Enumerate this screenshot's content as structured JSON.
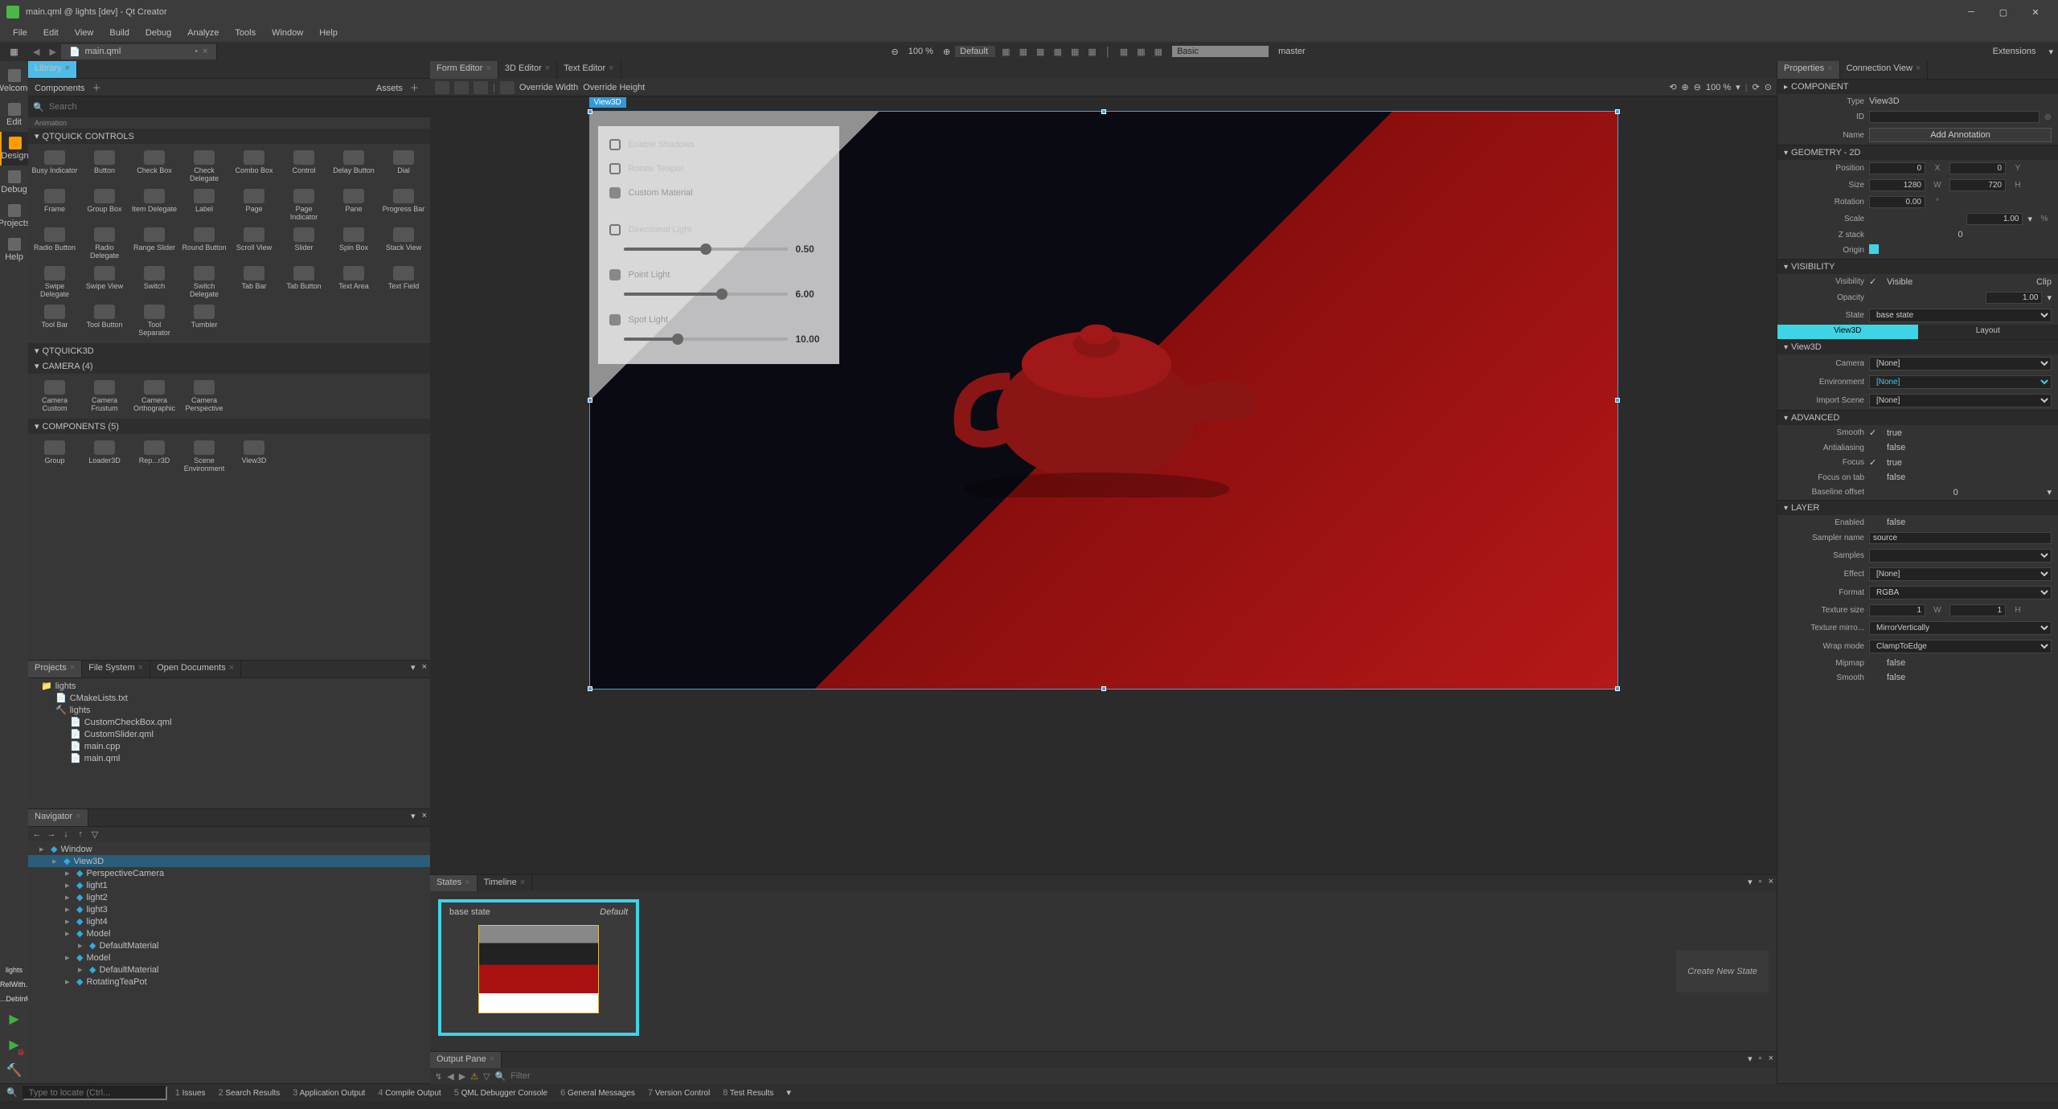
{
  "window": {
    "title": "main.qml @ lights [dev] - Qt Creator"
  },
  "menu": [
    "File",
    "Edit",
    "View",
    "Build",
    "Debug",
    "Analyze",
    "Tools",
    "Window",
    "Help"
  ],
  "file_tabs": [
    {
      "name": "main.qml",
      "active": true
    }
  ],
  "top_toolbar": {
    "zoom": "100 %",
    "style": "Default",
    "kit": "Basic",
    "branch": "master",
    "extras_label": "Extensions"
  },
  "left_modes": [
    {
      "id": "welcome",
      "label": "Welcome"
    },
    {
      "id": "edit",
      "label": "Edit"
    },
    {
      "id": "design",
      "label": "Design",
      "active": true
    },
    {
      "id": "debug",
      "label": "Debug"
    },
    {
      "id": "projects",
      "label": "Projects"
    },
    {
      "id": "help",
      "label": "Help"
    }
  ],
  "build_status": {
    "project": "lights",
    "config": "RelWith...",
    "detail": "...DebInfo"
  },
  "library": {
    "tabs": [
      "Library"
    ],
    "subtabs": {
      "left": "Components",
      "right": "Assets"
    },
    "search_placeholder": "Search",
    "sections": [
      {
        "title": "QTQUICK CONTROLS",
        "items": [
          "Busy Indicator",
          "Button",
          "Check Box",
          "Check Delegate",
          "Combo Box",
          "Control",
          "Delay Button",
          "Dial",
          "Frame",
          "Group Box",
          "Item Delegate",
          "Label",
          "Page",
          "Page Indicator",
          "Pane",
          "Progress Bar",
          "Radio Button",
          "Radio Delegate",
          "Range Slider",
          "Round Button",
          "Scroll View",
          "Slider",
          "Spin Box",
          "Stack View",
          "Swipe Delegate",
          "Swipe View",
          "Switch",
          "Switch Delegate",
          "Tab Bar",
          "Tab Button",
          "Text Area",
          "Text Field",
          "Tool Bar",
          "Tool Button",
          "Tool Separator",
          "Tumbler"
        ]
      },
      {
        "title": "QTQUICK3D",
        "items": []
      },
      {
        "title": "CAMERA (4)",
        "items": [
          "Camera Custom",
          "Camera Frustum",
          "Camera Orthographic",
          "Camera Perspective"
        ]
      },
      {
        "title": "COMPONENTS (5)",
        "items": [
          "Group",
          "Loader3D",
          "Rep...r3D",
          "Scene Environment",
          "View3D"
        ]
      }
    ]
  },
  "projects_panel": {
    "tabs": [
      "Projects",
      "File System",
      "Open Documents"
    ],
    "tree": [
      {
        "name": "lights",
        "depth": 0,
        "type": "folder"
      },
      {
        "name": "CMakeLists.txt",
        "depth": 1,
        "type": "cmake"
      },
      {
        "name": "lights",
        "depth": 1,
        "type": "target"
      },
      {
        "name": "CustomCheckBox.qml",
        "depth": 2,
        "type": "qml"
      },
      {
        "name": "CustomSlider.qml",
        "depth": 2,
        "type": "qml"
      },
      {
        "name": "main.cpp",
        "depth": 2,
        "type": "cpp"
      },
      {
        "name": "main.qml",
        "depth": 2,
        "type": "qml"
      }
    ]
  },
  "navigator": {
    "tab": "Navigator",
    "items": [
      {
        "name": "Window",
        "depth": 0
      },
      {
        "name": "View3D",
        "depth": 1,
        "sel": true
      },
      {
        "name": "PerspectiveCamera",
        "depth": 2
      },
      {
        "name": "light1",
        "depth": 2
      },
      {
        "name": "light2",
        "depth": 2
      },
      {
        "name": "light3",
        "depth": 2
      },
      {
        "name": "light4",
        "depth": 2
      },
      {
        "name": "Model",
        "depth": 2
      },
      {
        "name": "DefaultMaterial",
        "depth": 3
      },
      {
        "name": "Model",
        "depth": 2
      },
      {
        "name": "DefaultMaterial",
        "depth": 3
      },
      {
        "name": "RotatingTeaPot",
        "depth": 2
      }
    ]
  },
  "editor": {
    "tabs": [
      "Form Editor",
      "3D Editor",
      "Text Editor"
    ],
    "active_tab": 0,
    "overrides": [
      "Override Width",
      "Override Height"
    ],
    "zoom": "100 %",
    "viewport_tag": "View3D",
    "panel": {
      "enable_shadows": {
        "label": "Enable Shadows",
        "checked": false
      },
      "rotate_teapot": {
        "label": "Rotate Teapot",
        "checked": false
      },
      "custom_material": {
        "label": "Custom Material",
        "disabled": true
      },
      "directional": {
        "label": "Directional Light",
        "checked": false,
        "value": "0.50",
        "pct": 50
      },
      "point": {
        "label": "Point Light",
        "disabled": true,
        "value": "6.00",
        "pct": 60
      },
      "spot": {
        "label": "Spot Light",
        "disabled": true,
        "value": "10.00",
        "pct": 33
      }
    }
  },
  "states": {
    "tabs": [
      "States",
      "Timeline"
    ],
    "cards": [
      {
        "name": "base state",
        "tag": "Default"
      }
    ],
    "new_label": "Create New State"
  },
  "output": {
    "tab": "Output Pane",
    "filter_placeholder": "Filter"
  },
  "properties": {
    "tabs": [
      "Properties",
      "Connection View"
    ],
    "component": {
      "header": "COMPONENT",
      "type_label": "Type",
      "type": "View3D",
      "id_label": "ID",
      "id": "",
      "name_label": "Name",
      "name_btn": "Add Annotation"
    },
    "geometry": {
      "header": "GEOMETRY - 2D",
      "position_label": "Position",
      "pos_x": "0",
      "pos_y": "0",
      "size_label": "Size",
      "size_w": "1280",
      "size_h": "720",
      "rotation_label": "Rotation",
      "rotation": "0.00",
      "rot_unit": "°",
      "scale_label": "Scale",
      "scale": "1.00",
      "scale_unit": "%",
      "z_label": "Z stack",
      "z": "0",
      "origin_label": "Origin"
    },
    "visibility": {
      "header": "VISIBILITY",
      "vis_label": "Visibility",
      "visible": "Visible",
      "clip": "Clip",
      "opacity_label": "Opacity",
      "opacity": "1.00",
      "state_label": "State",
      "state": "base state"
    },
    "view3d": {
      "tab1": "View3D",
      "tab2": "Layout",
      "camera_label": "Camera",
      "camera": "[None]",
      "env_label": "Environment",
      "env": "[None]",
      "import_label": "Import Scene",
      "import_scene": "[None]"
    },
    "advanced": {
      "header": "ADVANCED",
      "smooth_label": "Smooth",
      "smooth": "true",
      "aa_label": "Antialiasing",
      "aa": "false",
      "focus_label": "Focus",
      "focus": "true",
      "focustab_label": "Focus on tab",
      "focustab": "false",
      "baseline_label": "Baseline offset",
      "baseline": "0"
    },
    "layer": {
      "header": "LAYER",
      "enabled_label": "Enabled",
      "enabled": "false",
      "sampler_label": "Sampler name",
      "sampler": "source",
      "samples_label": "Samples",
      "effect_label": "Effect",
      "effect": "[None]",
      "format_label": "Format",
      "format": "RGBA",
      "texsize_label": "Texture size",
      "tex_w": "1",
      "tex_h": "1",
      "mirror_label": "Texture mirro...",
      "mirror": "MirrorVertically",
      "wrap_label": "Wrap mode",
      "wrap": "ClampToEdge",
      "mipmap_label": "Mipmap",
      "mipmap": "false",
      "smooth_label": "Smooth",
      "smooth": "false"
    }
  },
  "statusbar": {
    "locator": "Type to locate (Ctrl...",
    "items": [
      {
        "n": "1",
        "t": "Issues"
      },
      {
        "n": "2",
        "t": "Search Results"
      },
      {
        "n": "3",
        "t": "Application Output"
      },
      {
        "n": "4",
        "t": "Compile Output"
      },
      {
        "n": "5",
        "t": "QML Debugger Console"
      },
      {
        "n": "6",
        "t": "General Messages"
      },
      {
        "n": "7",
        "t": "Version Control"
      },
      {
        "n": "8",
        "t": "Test Results"
      }
    ]
  }
}
